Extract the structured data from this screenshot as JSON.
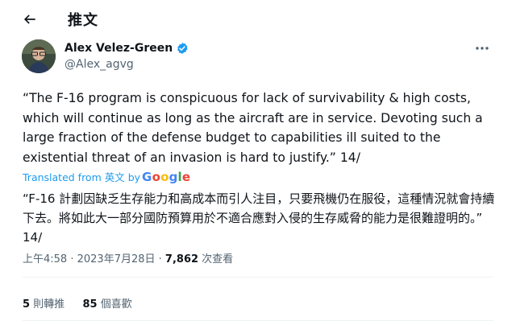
{
  "header": {
    "back_icon": "arrow-left-icon",
    "title": "推文"
  },
  "author": {
    "name": "Alex Velez-Green",
    "handle": "@Alex_agvg",
    "verified_icon": "verified-badge-icon",
    "verified_color": "#1d9bf0",
    "more_icon": "more-horizontal-icon"
  },
  "tweet": {
    "text": "“The F-16 program is conspicuous for lack of survivability & high costs, which will continue as long as the aircraft are in service. Devoting such a large fraction of the defense budget to capabilities ill suited to the existential threat of an invasion is hard to justify.” 14/",
    "translation_label": "Translated from 英文 by",
    "translation_provider": [
      "G",
      "o",
      "o",
      "g",
      "l",
      "e"
    ],
    "translated_text": "“F-16 計劃因缺乏生存能力和高成本而引人注目，只要飛機仍在服役，這種情況就會持續下去。將如此大一部分國防預算用於不適合應對入侵的生存威脅的能力是很難證明的。” 14/"
  },
  "meta": {
    "time": "上午4:58",
    "sep1": " · ",
    "date": "2023年7月28日",
    "sep2": " · ",
    "views": "7,862",
    "views_label": " 次查看"
  },
  "stats": {
    "retweets": "5",
    "retweets_label": " 則轉推",
    "likes": "85",
    "likes_label": " 個喜歡"
  },
  "colors": {
    "link": "#1d9bf0",
    "secondary_text": "#536471",
    "divider": "#eff3f4",
    "google_blue": "#4285f4",
    "google_red": "#ea4335",
    "google_yellow": "#fbbc05",
    "google_green": "#34a853"
  }
}
